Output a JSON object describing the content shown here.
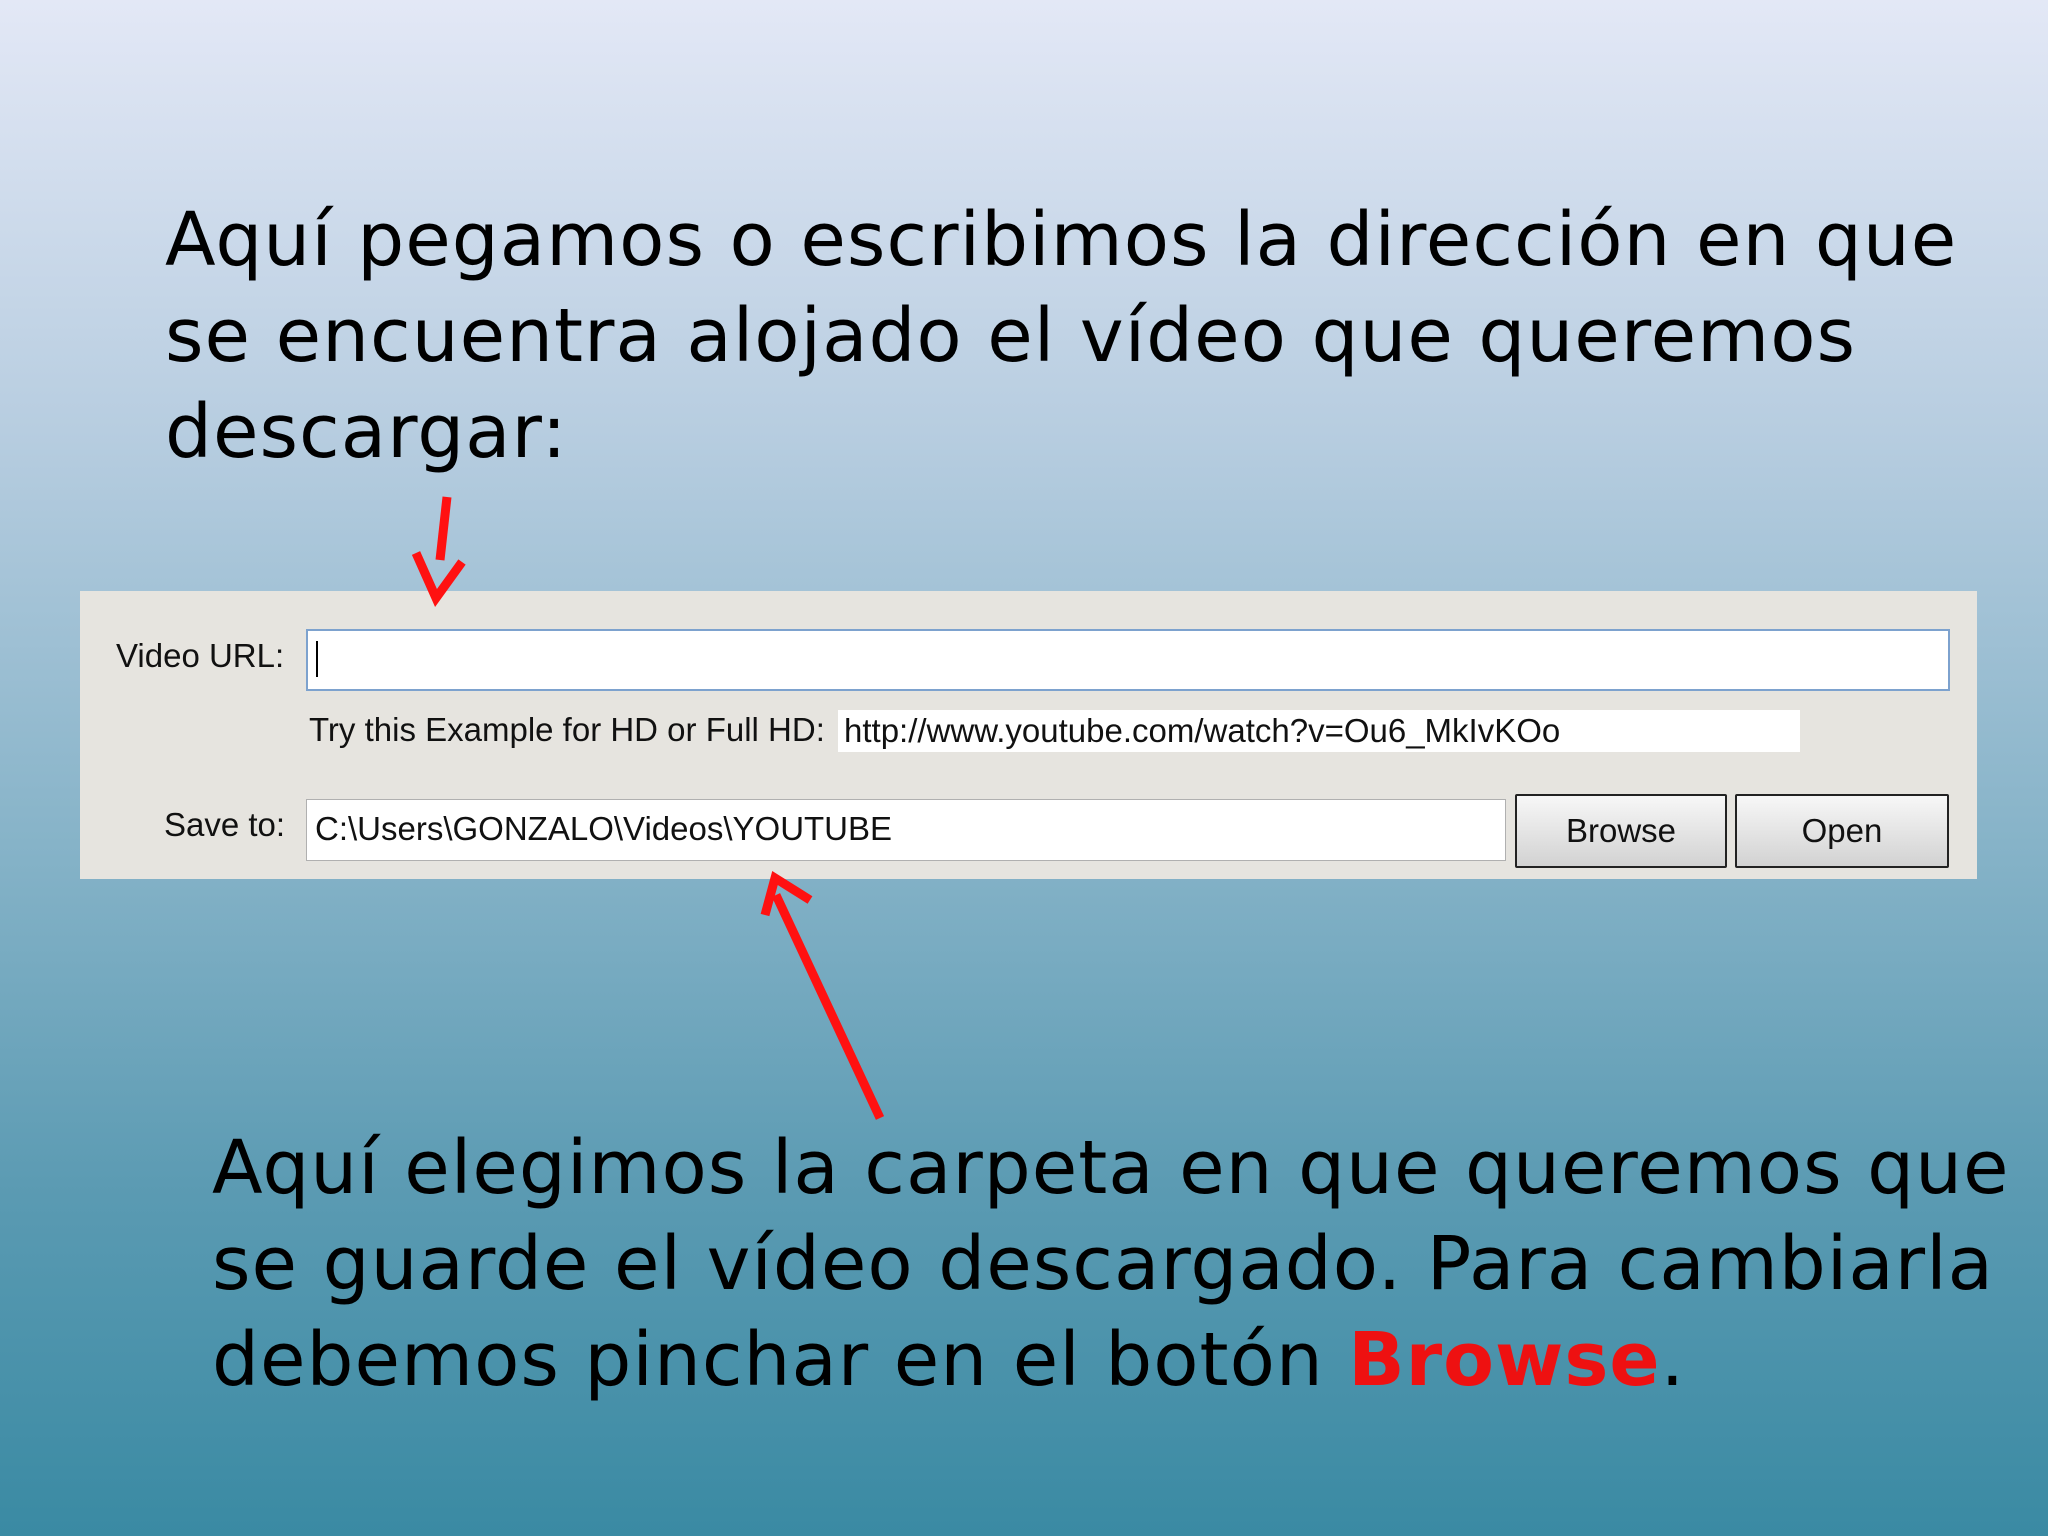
{
  "slide": {
    "top_text": "Aquí pegamos o escribimos la dirección en que se encuentra alojado el vídeo que queremos descargar:",
    "bottom_text_before": "Aquí elegimos la carpeta en que queremos que se guarde el vídeo descargado. Para cambiarla debemos pinchar en el botón ",
    "bottom_text_highlight": "Browse",
    "bottom_text_after": ".",
    "highlight_color": "#ee1111",
    "arrow_color": "#ff1111"
  },
  "form": {
    "video_url_label": "Video URL:",
    "video_url_value": "",
    "example_label": "Try this Example for HD or Full HD:",
    "example_url": "http://www.youtube.com/watch?v=Ou6_MkIvKOo",
    "save_to_label": "Save to:",
    "save_to_value": "C:\\Users\\GONZALO\\Videos\\YOUTUBE",
    "browse_label": "Browse",
    "open_label": "Open"
  }
}
